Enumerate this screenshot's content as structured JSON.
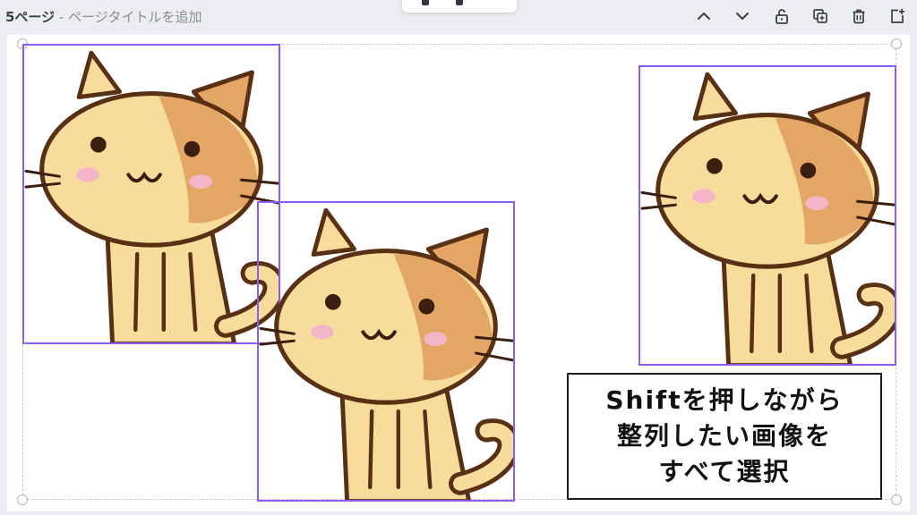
{
  "header": {
    "page_label": "5ページ",
    "title_placeholder": " - ページタイトルを追加"
  },
  "toolbar_icons": [
    {
      "name": "chevron-up-icon"
    },
    {
      "name": "chevron-down-icon"
    },
    {
      "name": "lock-icon"
    },
    {
      "name": "duplicate-page-icon"
    },
    {
      "name": "trash-icon"
    },
    {
      "name": "add-page-icon"
    }
  ],
  "canvas": {
    "caption_lines": [
      "Shiftを押しながら",
      "整列したい画像を",
      "すべて選択"
    ],
    "selection_color": "#8b5cf6",
    "image_count": 3
  }
}
